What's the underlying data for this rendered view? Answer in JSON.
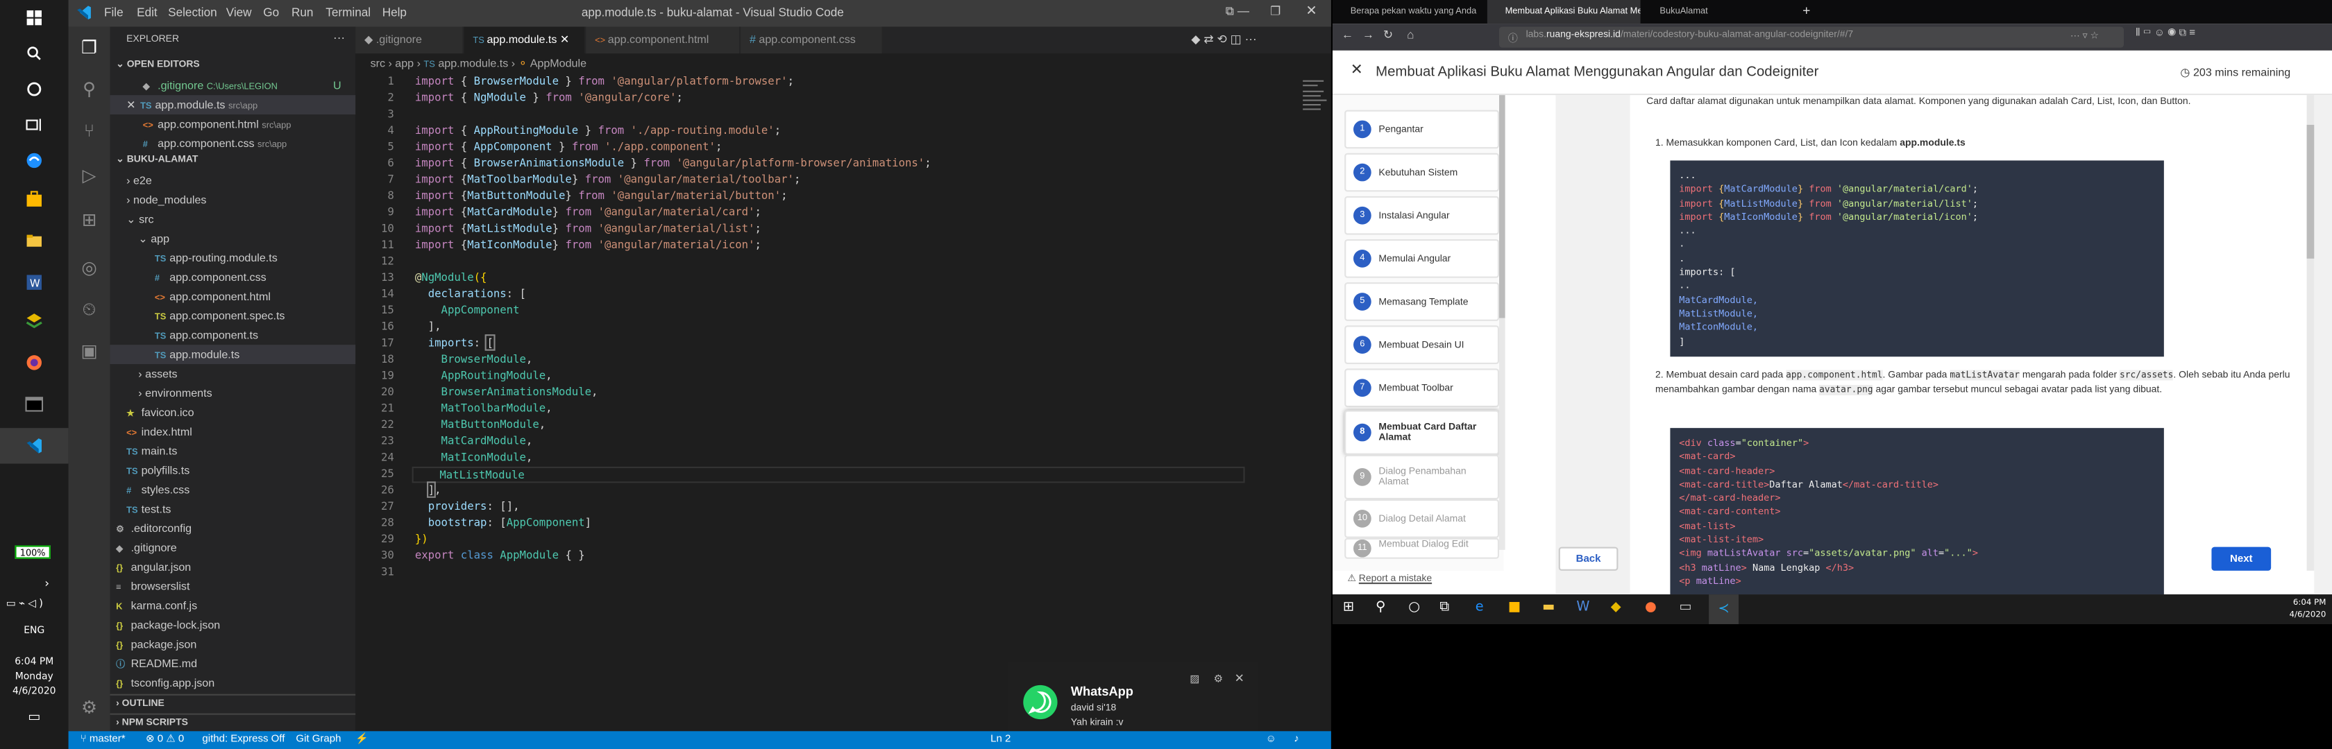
{
  "ltask": {
    "battery": "100%",
    "time": "6:04 PM",
    "day": "Monday",
    "date": "4/6/2020",
    "lang": "ENG"
  },
  "vscode": {
    "title": "app.module.ts - buku-alamat - Visual Studio Code",
    "menus": [
      "File",
      "Edit",
      "Selection",
      "View",
      "Go",
      "Run",
      "Terminal",
      "Help"
    ],
    "explorer": "EXPLORER",
    "open_editors": "OPEN EDITORS",
    "open": [
      {
        "name": ".gitignore",
        "path": "C:\\Users\\LEGION",
        "badge": "U"
      },
      {
        "name": "app.module.ts",
        "path": "src\\app",
        "close": "✕"
      },
      {
        "name": "app.component.html",
        "path": "src\\app"
      },
      {
        "name": "app.component.css",
        "path": "src\\app"
      }
    ],
    "project": "BUKU-ALAMAT",
    "tree": [
      "e2e",
      "node_modules",
      "src",
      "app",
      "app-routing.module.ts",
      "app.component.css",
      "app.component.html",
      "app.component.spec.ts",
      "app.component.ts",
      "app.module.ts",
      "assets",
      "environments",
      "favicon.ico",
      "index.html",
      "main.ts",
      "polyfills.ts",
      "styles.css",
      "test.ts",
      ".editorconfig",
      ".gitignore",
      "angular.json",
      "browserslist",
      "karma.conf.js",
      "package-lock.json",
      "package.json",
      "README.md",
      "tsconfig.app.json"
    ],
    "outline": "OUTLINE",
    "npm": "NPM SCRIPTS",
    "tabs": [
      ".gitignore",
      "app.module.ts",
      "app.component.html",
      "app.component.css"
    ],
    "breadcrumb": [
      "src",
      "app",
      "app.module.ts",
      "AppModule"
    ],
    "status": {
      "branch": "master*",
      "errors": "⊗ 0 ⚠ 0",
      "githd": "githd: Express Off",
      "graph": "Git Graph",
      "ln": "Ln 2"
    }
  },
  "whatsapp": {
    "title": "WhatsApp",
    "sender": "david si'18",
    "message": "Yah kirain :v"
  },
  "browser": {
    "tabs": [
      "Berapa pekan waktu yang Anda",
      "Membuat Aplikasi Buku Alamat Me",
      "BukuAlamat"
    ],
    "url_host": "labs.",
    "url_domain": "ruang-ekspresi.id",
    "url_path": "/materi/codestory-buku-alamat-angular-codeigniter/#/7",
    "page_title": "Membuat Aplikasi Buku Alamat Menggunakan Angular dan Codeigniter",
    "remaining": "203 mins remaining",
    "steps": [
      {
        "n": "1",
        "label": "Pengantar"
      },
      {
        "n": "2",
        "label": "Kebutuhan Sistem"
      },
      {
        "n": "3",
        "label": "Instalasi Angular"
      },
      {
        "n": "4",
        "label": "Memulai Angular"
      },
      {
        "n": "5",
        "label": "Memasang Template"
      },
      {
        "n": "6",
        "label": "Membuat Desain UI"
      },
      {
        "n": "7",
        "label": "Membuat Toolbar"
      },
      {
        "n": "8",
        "label": "Membuat Card Daftar Alamat"
      },
      {
        "n": "9",
        "label": "Dialog Penambahan Alamat"
      },
      {
        "n": "10",
        "label": "Dialog Detail Alamat"
      },
      {
        "n": "11",
        "label": "Membuat Dialog Edit"
      }
    ],
    "report": "Report a mistake",
    "intro": "Card daftar alamat digunakan untuk menampilkan data alamat. Komponen yang digunakan adalah Card, List, Icon, dan Button.",
    "li1_pre": "Memasukkan komponen Card, List, dan Icon kedalam ",
    "li1_bold": "app.module.ts",
    "li2_a": "Membuat desain card pada ",
    "li2_code1": "app.component.html",
    "li2_b": ". Gambar pada ",
    "li2_code2": "matListAvatar",
    "li2_c": " mengarah pada folder ",
    "li2_code3": "src/assets",
    "li2_d": ". Oleh sebab itu Anda perlu menambahkan gambar dengan nama ",
    "li2_code4": "avatar.png",
    "li2_e": " agar gambar tersebut muncul sebagai avatar pada list yang dibuat.",
    "back": "Back",
    "next": "Next",
    "taskbar_time": "6:04 PM",
    "taskbar_date": "4/6/2020"
  }
}
